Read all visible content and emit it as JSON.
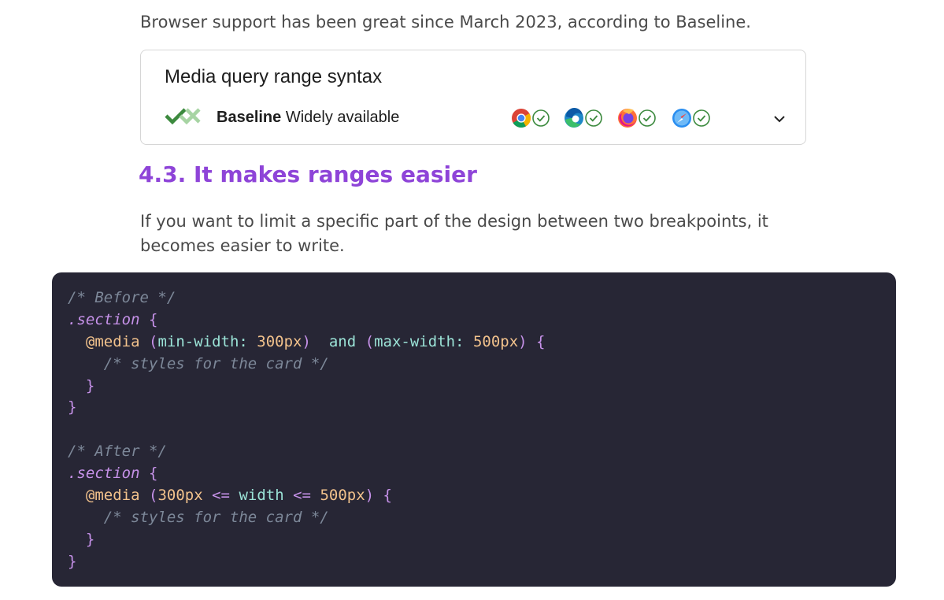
{
  "intro_text": "Browser support has been great since March 2023, according to Baseline.",
  "baseline_card": {
    "title": "Media query range syntax",
    "status_strong": "Baseline",
    "status_text": " Widely available",
    "browsers": [
      {
        "name": "chrome",
        "icon": "chrome-icon",
        "supported": true
      },
      {
        "name": "edge",
        "icon": "edge-icon",
        "supported": true
      },
      {
        "name": "firefox",
        "icon": "firefox-icon",
        "supported": true
      },
      {
        "name": "safari",
        "icon": "safari-icon",
        "supported": true
      }
    ],
    "accent_color": "#3c8a3e"
  },
  "heading": "4.3. It makes ranges easier",
  "paragraph": "If you want to limit a specific part of the design between two breakpoints, it becomes easier to write.",
  "code": {
    "before_comment": "/* Before */",
    "selector": ".section",
    "open_brace": "{",
    "close_brace": "}",
    "at_rule": "@media",
    "min_prop": "min-width",
    "min_val": "300px",
    "and_kw": "and",
    "max_prop": "max-width",
    "max_val": "500px",
    "inner_comment": "/* styles for the card */",
    "after_comment": "/* After */",
    "range_low": "300px",
    "range_op": "<=",
    "range_feature": "width",
    "range_high": "500px"
  },
  "colors": {
    "heading": "#8e44d8",
    "code_bg": "#272635"
  }
}
